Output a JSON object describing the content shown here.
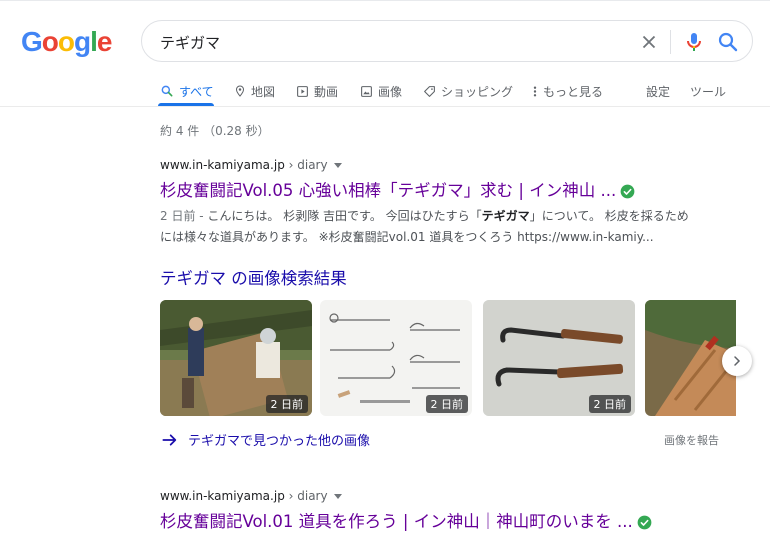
{
  "logo": {
    "text": "Google",
    "letters": [
      {
        "ch": "G",
        "color": "#4285F4"
      },
      {
        "ch": "o",
        "color": "#EA4335"
      },
      {
        "ch": "o",
        "color": "#FBBC05"
      },
      {
        "ch": "g",
        "color": "#4285F4"
      },
      {
        "ch": "l",
        "color": "#34A853"
      },
      {
        "ch": "e",
        "color": "#EA4335"
      }
    ]
  },
  "search": {
    "query": "テギガマ"
  },
  "tabs": {
    "all": "すべて",
    "maps": "地図",
    "videos": "動画",
    "images": "画像",
    "shopping": "ショッピング",
    "more": "もっと見る",
    "settings": "設定",
    "tools": "ツール"
  },
  "stats": "約 4 件 （0.28 秒）",
  "result1": {
    "domain": "www.in-kamiyama.jp",
    "path": " › diary",
    "title": "杉皮奮闘記Vol.05 心強い相棒「テギガマ」求む | イン神山 ...",
    "date": "2 日前 - ",
    "snippet_pre": "こんにちは。 杉剥隊 吉田です。 今回はひたすら「",
    "snippet_bold": "テギガマ",
    "snippet_post": "」について。 杉皮を採るためには様々な道具があります。 ※杉皮奮闘記vol.01 道具をつくろう https://www.in-kamiy..."
  },
  "images_section": {
    "heading": "テギガマ の画像検索結果",
    "thumbs": [
      {
        "badge": "2 日前",
        "desc": "two workers with bark tools in cedar forest"
      },
      {
        "badge": "2 日前",
        "desc": "technical drawing of sickle tools"
      },
      {
        "badge": "2 日前",
        "desc": "two hooked iron tools with wooden handles"
      },
      {
        "badge": "",
        "desc": "cedar bark close-up"
      }
    ],
    "more_link": "テギガマで見つかった他の画像",
    "report": "画像を報告"
  },
  "result2": {
    "domain": "www.in-kamiyama.jp",
    "path": " › diary",
    "title": "杉皮奮闘記Vol.01 道具を作ろう | イン神山｜神山町のいまを ..."
  },
  "colors": {
    "accent_blue": "#1a73e8",
    "visited_link": "#660099",
    "link": "#1a0dab",
    "verified_green": "#34A853"
  }
}
